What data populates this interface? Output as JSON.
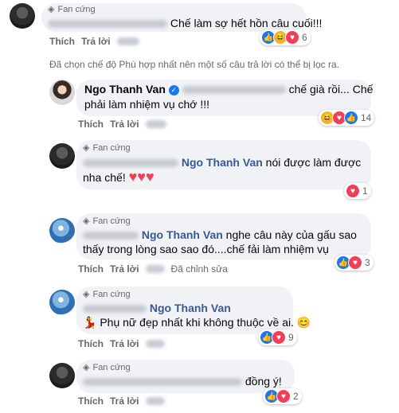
{
  "badge": "Fan cứng",
  "actions": {
    "like": "Thích",
    "reply": "Trả lời",
    "edited": "Đã chỉnh sửa"
  },
  "filter_notice": "Đã chọn chế độ Phù hợp nhất nên một số câu trả lời có thể bị lọc ra.",
  "comment1": {
    "text": "Chế làm sợ hết hồn câu cuối!!!",
    "reaction_count": "6"
  },
  "reply_ntv": {
    "name": "Ngo Thanh Van",
    "text_1": "chế già rồi... Chế",
    "text_2": "phải làm nhiệm vụ chớ !!!",
    "reaction_count": "14"
  },
  "reply2": {
    "mention": "Ngo Thanh Van",
    "text_1": "nói được làm được",
    "text_2": "nha chế!",
    "hearts": "♥♥♥",
    "reaction_count": "1"
  },
  "reply3": {
    "mention": "Ngo Thanh Van",
    "text_1": "nghe câu này của gấu sao",
    "text_2": "thấy trong lòng sao sao đó....chế fải làm nhiệm vụ",
    "reaction_count": "3"
  },
  "reply4": {
    "mention": "Ngo Thanh Van",
    "text": "Phụ nữ đẹp nhất khi không thuộc về ai.",
    "emoji": "😊",
    "prefix_emoji": "💃",
    "reaction_count": "9"
  },
  "reply5": {
    "text": "đồng ý!",
    "reaction_count": "2"
  }
}
